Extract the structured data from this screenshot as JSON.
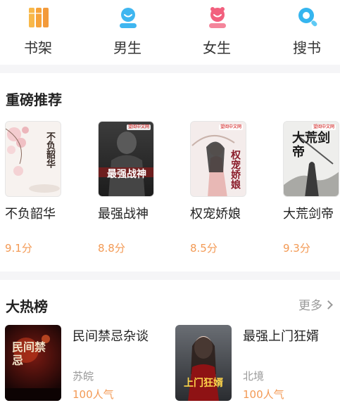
{
  "nav": {
    "items": [
      {
        "label": "书架",
        "icon": "bookshelf-icon",
        "color": "#f6a93b"
      },
      {
        "label": "男生",
        "icon": "male-icon",
        "color": "#3fb6f0"
      },
      {
        "label": "女生",
        "icon": "female-icon",
        "color": "#f2607e"
      },
      {
        "label": "搜书",
        "icon": "search-icon",
        "color": "#35b5ef"
      }
    ]
  },
  "featured": {
    "title": "重磅推荐",
    "books": [
      {
        "title": "不负韶华",
        "score": "9.1分",
        "cover_text": "不负韶华"
      },
      {
        "title": "最强战神",
        "score": "8.8分",
        "cover_text": "最强战神",
        "badge": "望阅中文网"
      },
      {
        "title": "权宠娇娘",
        "score": "8.5分",
        "cover_text": "权宠娇娘",
        "badge": "望阅中文网"
      },
      {
        "title": "大荒剑帝",
        "score": "9.3分",
        "cover_text": "大荒剑帝",
        "badge": "望阅中文网"
      }
    ]
  },
  "hot": {
    "title": "大热榜",
    "more_label": "更多",
    "books": [
      {
        "title": "民间禁忌杂谈",
        "author": "苏皖",
        "popularity": "100人气",
        "cover_text": "民间禁忌"
      },
      {
        "title": "最强上门狂婿",
        "author": "北境",
        "popularity": "100人气",
        "cover_text": "上门狂婿"
      }
    ]
  },
  "colors": {
    "accent_orange": "#f39a55",
    "background": "#f5f5f7"
  }
}
